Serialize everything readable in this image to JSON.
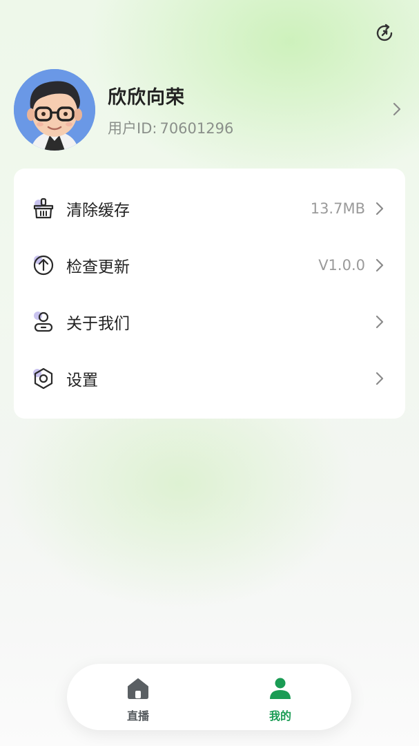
{
  "header": {
    "refresh_icon": "refresh-icon"
  },
  "profile": {
    "nickname": "欣欣向荣",
    "uid_label": "用户ID:",
    "uid_value": "70601296",
    "avatar": "avatar-cartoon-man-with-glasses"
  },
  "menu": {
    "items": [
      {
        "label": "清除缓存",
        "value": "13.7MB",
        "icon": "broom-basket-icon"
      },
      {
        "label": "检查更新",
        "value": "V1.0.0",
        "icon": "upload-arrow-icon"
      },
      {
        "label": "关于我们",
        "value": "",
        "icon": "user-icon"
      },
      {
        "label": "设置",
        "value": "",
        "icon": "hexagon-gear-icon"
      }
    ]
  },
  "tabbar": {
    "tabs": [
      {
        "label": "直播",
        "icon": "home-icon",
        "active": false
      },
      {
        "label": "我的",
        "icon": "person-icon",
        "active": true
      }
    ]
  },
  "colors": {
    "accent_green": "#1a9c54",
    "icon_dot_purple": "#c9c3ef",
    "inactive_gray": "#555a5e"
  }
}
